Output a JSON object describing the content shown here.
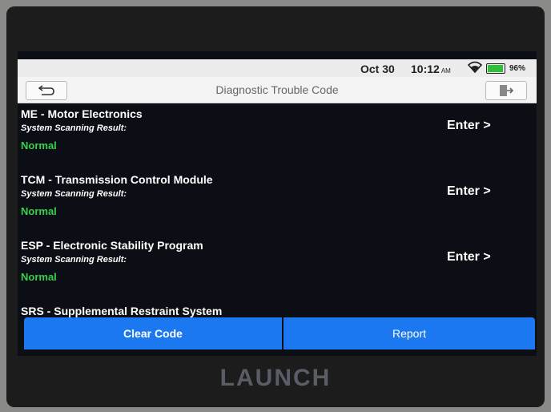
{
  "status_bar": {
    "date": "Oct 30",
    "time": "10:12",
    "ampm": "AM",
    "battery_percent": "96%",
    "battery_level": 0.96,
    "icons": [
      "wifi-icon",
      "battery-icon"
    ]
  },
  "header": {
    "title": "Diagnostic Trouble Code",
    "back_icon": "back-arrow-icon",
    "exit_icon": "exit-icon"
  },
  "systems": [
    {
      "name": "ME - Motor Electronics",
      "result_label": "System Scanning Result:",
      "result": "Normal",
      "action": "Enter >"
    },
    {
      "name": "TCM - Transmission Control Module",
      "result_label": "System Scanning Result:",
      "result": "Normal",
      "action": "Enter >"
    },
    {
      "name": "ESP - Electronic Stability Program",
      "result_label": "System Scanning Result:",
      "result": "Normal",
      "action": "Enter >"
    },
    {
      "name": "SRS - Supplemental Restraint System"
    }
  ],
  "buttons": {
    "clear": "Clear Code",
    "report": "Report"
  },
  "brand": "LAUNCH",
  "colors": {
    "accent": "#1b78f0",
    "normal": "#37d04b",
    "background": "#0b0e14"
  }
}
